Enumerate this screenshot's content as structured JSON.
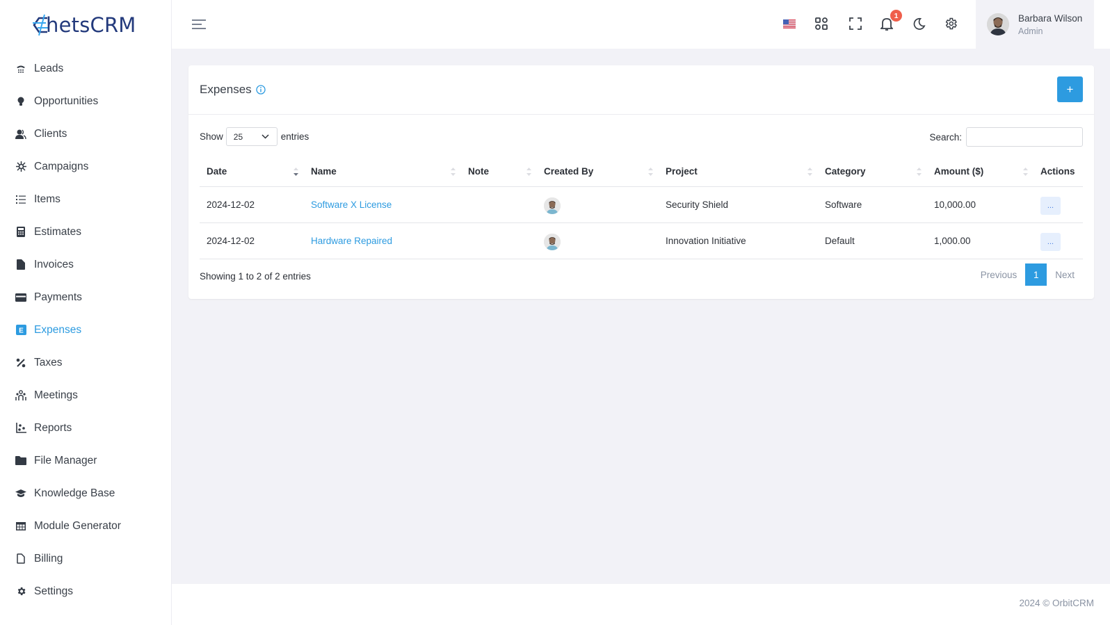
{
  "brand": {
    "name": "hetsCRM",
    "accent": "#2d9be0"
  },
  "sidebar": {
    "items": [
      {
        "label": "Leads",
        "icon": "phone-icon",
        "active": false
      },
      {
        "label": "Opportunities",
        "icon": "lightbulb-icon",
        "active": false
      },
      {
        "label": "Clients",
        "icon": "users-icon",
        "active": false
      },
      {
        "label": "Campaigns",
        "icon": "virus-icon",
        "active": false
      },
      {
        "label": "Items",
        "icon": "list-icon",
        "active": false
      },
      {
        "label": "Estimates",
        "icon": "calculator-icon",
        "active": false
      },
      {
        "label": "Invoices",
        "icon": "file-icon",
        "active": false
      },
      {
        "label": "Payments",
        "icon": "credit-card-icon",
        "active": false
      },
      {
        "label": "Expenses",
        "icon": "e-square-icon",
        "active": true
      },
      {
        "label": "Taxes",
        "icon": "percent-icon",
        "active": false
      },
      {
        "label": "Meetings",
        "icon": "people-group-icon",
        "active": false
      },
      {
        "label": "Reports",
        "icon": "chart-scatter-icon",
        "active": false
      },
      {
        "label": "File Manager",
        "icon": "folder-icon",
        "active": false
      },
      {
        "label": "Knowledge Base",
        "icon": "graduation-cap-icon",
        "active": false
      },
      {
        "label": "Module Generator",
        "icon": "table-icon",
        "active": false
      },
      {
        "label": "Billing",
        "icon": "file-outline-icon",
        "active": false
      },
      {
        "label": "Settings",
        "icon": "gear-icon",
        "active": false
      }
    ]
  },
  "header": {
    "notification_count": "1",
    "user": {
      "name": "Barbara Wilson",
      "role": "Admin"
    }
  },
  "page": {
    "title": "Expenses",
    "add_label": "+",
    "show_label": "Show",
    "entries_label": "entries",
    "page_size": "25",
    "search_label": "Search:",
    "search_value": "",
    "columns": [
      "Date",
      "Name",
      "Note",
      "Created By",
      "Project",
      "Category",
      "Amount ($)",
      "Actions"
    ],
    "rows": [
      {
        "date": "2024-12-02",
        "name": "Software X License",
        "note": "",
        "project": "Security Shield",
        "category": "Software",
        "amount": "10,000.00",
        "action": "..."
      },
      {
        "date": "2024-12-02",
        "name": "Hardware Repaired",
        "note": "",
        "project": "Innovation Initiative",
        "category": "Default",
        "amount": "1,000.00",
        "action": "..."
      }
    ],
    "info": "Showing 1 to 2 of 2 entries",
    "pager": {
      "previous": "Previous",
      "current": "1",
      "next": "Next"
    }
  },
  "footer": {
    "text": "2024 © OrbitCRM"
  }
}
